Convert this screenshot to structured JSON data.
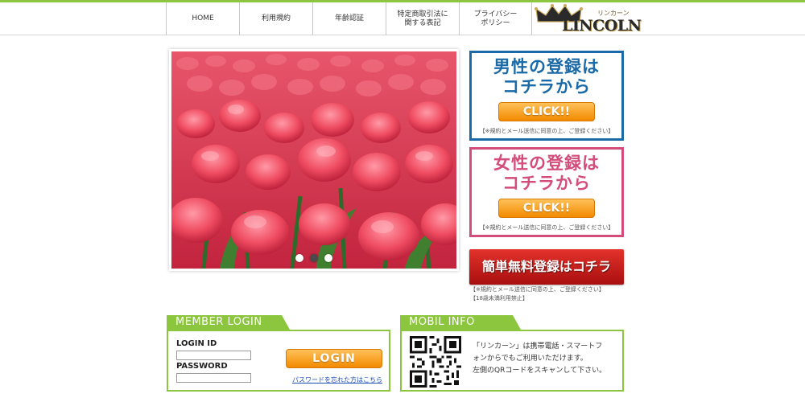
{
  "nav": [
    {
      "label": "HOME"
    },
    {
      "label": "利用規約"
    },
    {
      "label": "年齢認証"
    },
    {
      "label": "特定商取引法に\n関する表記"
    },
    {
      "label": "プライバシー\nポリシー"
    }
  ],
  "logo": {
    "kana": "リンカーン",
    "word": "LINCOLN"
  },
  "slider": {
    "dots": 3,
    "active_index": 1
  },
  "register_male": {
    "title_line1": "男性の登録は",
    "title_line2": "コチラから",
    "button": "CLICK!!",
    "note": "【※規約とメール送信に同意の上、ご登録ください】"
  },
  "register_female": {
    "title_line1": "女性の登録は",
    "title_line2": "コチラから",
    "button": "CLICK!!",
    "note": "【※規約とメール送信に同意の上、ご登録ください】"
  },
  "easy_register": {
    "button": "簡単無料登録はコチラ",
    "note_line1": "【※規約とメール送信に同意の上、ご登録ください】",
    "note_line2": "【18歳未満利用禁止】"
  },
  "member_login": {
    "tab": "MEMBER LOGIN",
    "id_label": "LOGIN ID",
    "password_label": "PASSWORD",
    "id_value": "",
    "password_value": "",
    "button": "LOGIN",
    "forgot_link": "パスワードを忘れた方はこちら"
  },
  "mobil_info": {
    "tab": "MOBIL INFO",
    "line1": "「リンカーン」は携帯電話・スマートフ",
    "line2": "ォンからでもご利用いただけます。",
    "line3": "左側のQRコードをスキャンして下さい。"
  },
  "colors": {
    "accent_green": "#8cc63f",
    "male_blue": "#1a6aa8",
    "female_pink": "#d44c7a",
    "orange": "#f28a00",
    "red": "#c0191a"
  }
}
